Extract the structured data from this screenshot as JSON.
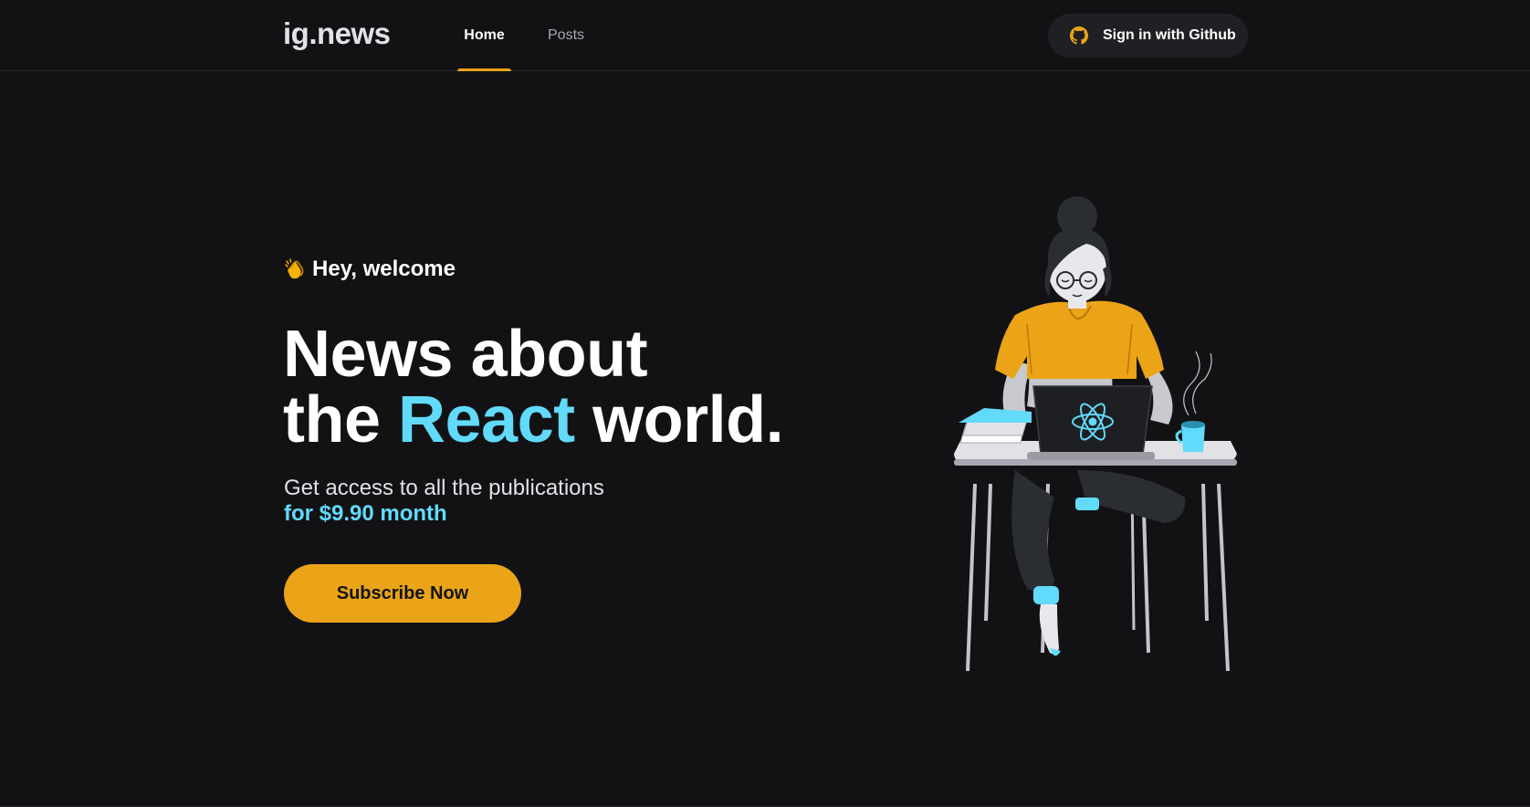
{
  "header": {
    "logo": "ig.news",
    "nav": [
      {
        "label": "Home",
        "active": true
      },
      {
        "label": "Posts",
        "active": false
      }
    ],
    "signin_label": "Sign in with Github",
    "signin_icon": "github-icon"
  },
  "hero": {
    "greeting_icon": "clapping-hands-icon",
    "greeting": "Hey, welcome",
    "headline_line1": "News about",
    "headline_the": "the",
    "headline_highlight": "React",
    "headline_end": "world.",
    "subtext": "Get access to all the publications",
    "price": "for $9.90 month",
    "cta_label": "Subscribe Now",
    "illustration": "woman-coding-laptop-illustration"
  },
  "colors": {
    "background": "#121214",
    "accent": "#eba417",
    "react_blue": "#61dafb",
    "button_dark": "#202024"
  }
}
